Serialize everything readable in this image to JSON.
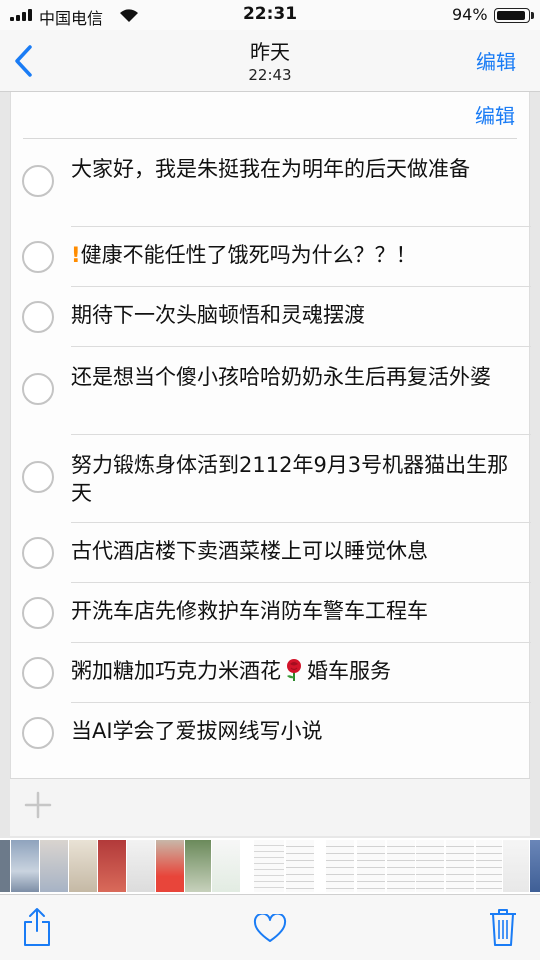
{
  "status_bar": {
    "carrier": "中国电信",
    "time": "22:31",
    "battery_percent": "94%",
    "battery_level": 0.94,
    "signal_icon": "signal-bars-icon",
    "wifi_icon": "wifi-icon",
    "battery_icon": "battery-icon"
  },
  "nav": {
    "back_icon": "chevron-left-icon",
    "title": "昨天",
    "subtitle": "22:43",
    "edit_label": "编辑"
  },
  "card": {
    "edit_label": "编辑"
  },
  "reminders": [
    {
      "text": "大家好，我是朱挺我在为明年的后天做准备"
    },
    {
      "priority": "!",
      "text": "健康不能任性了饿死吗为什么？？！"
    },
    {
      "text": "期待下一次头脑顿悟和灵魂摆渡"
    },
    {
      "text": "还是想当个傻小孩哈哈奶奶永生后再复活外婆"
    },
    {
      "text": "努力锻炼身体活到2112年9月3号机器猫出生那天"
    },
    {
      "text": "古代酒店楼下卖酒菜楼上可以睡觉休息"
    },
    {
      "text": "开洗车店先修救护车消防车警车工程车"
    },
    {
      "text_before": "粥加糖加巧克力米酒花",
      "emoji": "rose-icon",
      "text_after": "婚车服务"
    },
    {
      "text": "当AI学会了爱拔网线写小说"
    }
  ],
  "add_row": {
    "icon": "plus-icon"
  },
  "toolbar": {
    "share_icon": "share-icon",
    "favorite_icon": "heart-icon",
    "delete_icon": "trash-icon"
  },
  "colors": {
    "accent": "#1a7cf5",
    "priority": "#ff8c00",
    "circle_border": "#c4c4c4"
  }
}
